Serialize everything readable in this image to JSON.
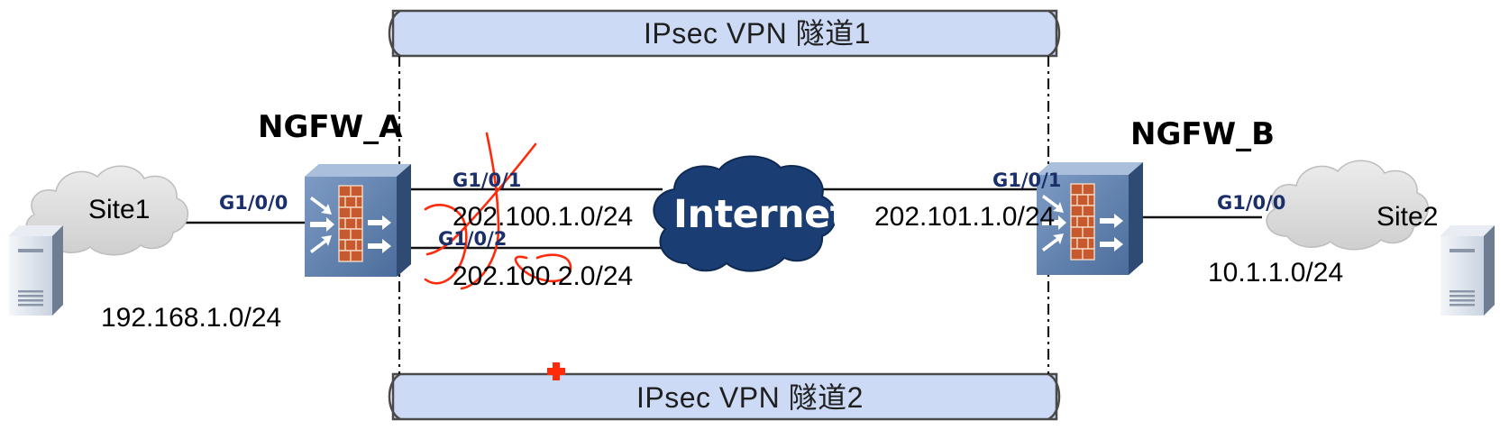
{
  "tunnels": {
    "top_label": "IPsec  VPN 隧道1",
    "bottom_label": "IPsec  VPN 隧道2"
  },
  "devices": {
    "left_name": "NGFW_A",
    "right_name": "NGFW_B"
  },
  "ports": {
    "a_g1_0_0": "G1/0/0",
    "a_g1_0_1": "G1/0/1",
    "a_g1_0_2": "G1/0/2",
    "b_g1_0_1": "G1/0/1",
    "b_g1_0_0": "G1/0/0"
  },
  "networks": {
    "site1_subnet": "192.168.1.0/24",
    "link1_subnet": "202.100.1.0/24",
    "link2_subnet": "202.100.2.0/24",
    "right_wan_subnet": "202.101.1.0/24",
    "site2_subnet": "10.1.1.0/24"
  },
  "clouds": {
    "site1": "Site1",
    "site2": "Site2",
    "internet": "Internet"
  },
  "colors": {
    "tunnel_fill": "#ccdaf5",
    "cloud_fill": "#dcdcdc",
    "internet_fill": "#1a3d73",
    "firewall_body": "#5f80ad",
    "annotation_red": "#ff2a0a",
    "brick": "#c65a2e"
  },
  "icons": [
    "firewall-icon",
    "server-icon",
    "cloud-icon",
    "medical-cross-icon"
  ]
}
